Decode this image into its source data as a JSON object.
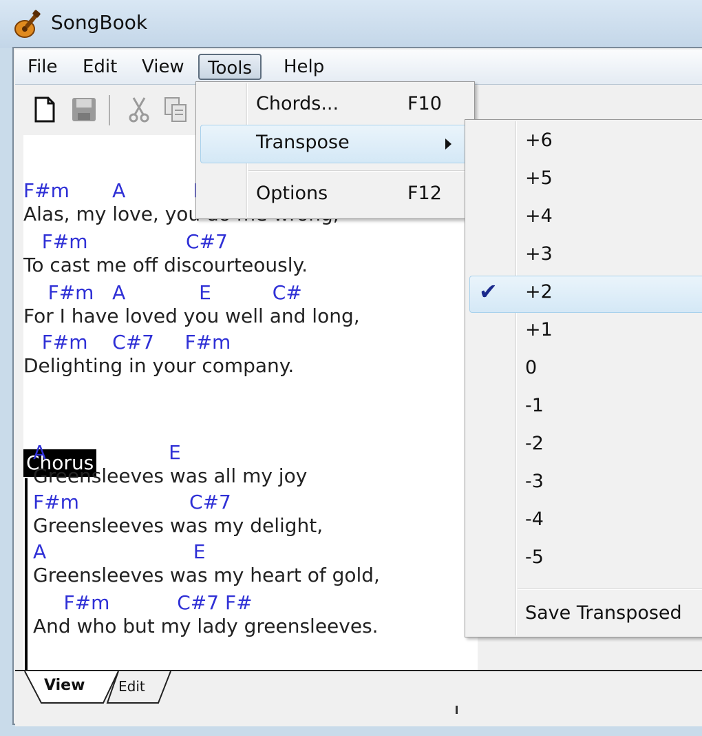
{
  "window": {
    "title": "SongBook"
  },
  "menubar": {
    "items": [
      "File",
      "Edit",
      "View",
      "Tools",
      "Help"
    ]
  },
  "tools_menu": {
    "items": [
      {
        "label": "Chords...",
        "shortcut": "F10"
      },
      {
        "label": "Transpose",
        "shortcut": ""
      },
      {
        "label": "Options",
        "shortcut": "F12"
      }
    ]
  },
  "transpose_menu": {
    "items": [
      "+6",
      "+5",
      "+4",
      "+3",
      "+2",
      "+1",
      "0",
      "-1",
      "-2",
      "-3",
      "-4",
      "-5"
    ],
    "checked": "+2",
    "save": "Save Transposed"
  },
  "song": {
    "verse": [
      {
        "kind": "chord",
        "text": "F#m       A           E        C#m"
      },
      {
        "kind": "lyric",
        "text": "Alas, my love, you do me wrong,"
      },
      {
        "kind": "chord",
        "text": "   F#m                C#7"
      },
      {
        "kind": "lyric",
        "text": "To cast me off discourteously."
      },
      {
        "kind": "chord",
        "text": "    F#m   A            E          C#"
      },
      {
        "kind": "lyric",
        "text": "For I have loved you well and long,"
      },
      {
        "kind": "chord",
        "text": "   F#m    C#7     F#m"
      },
      {
        "kind": "lyric",
        "text": "Delighting in your company."
      }
    ],
    "chorus_label": "Chorus",
    "chorus": [
      {
        "kind": "chord",
        "text": "A                    E"
      },
      {
        "kind": "lyric",
        "text": "Greensleeves was all my joy"
      },
      {
        "kind": "chord",
        "text": "F#m                  C#7"
      },
      {
        "kind": "lyric",
        "text": "Greensleeves was my delight,"
      },
      {
        "kind": "chord",
        "text": "A                        E"
      },
      {
        "kind": "lyric",
        "text": "Greensleeves was my heart of gold,"
      },
      {
        "kind": "chord",
        "text": "     F#m           C#7 F#"
      },
      {
        "kind": "lyric",
        "text": "And who but my lady greensleeves."
      }
    ]
  },
  "tabs": [
    "View",
    "Edit"
  ]
}
